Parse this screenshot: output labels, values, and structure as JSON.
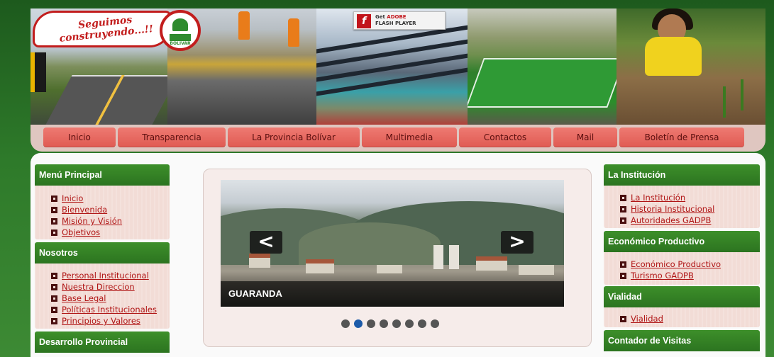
{
  "banner": {
    "logo_text": "Seguimos construyendo...!!",
    "seal_text": "BOLIVAR",
    "flash_badge": {
      "line1_prefix": "Get ",
      "line1_accent": "ADOBE",
      "line2": "FLASH PLAYER"
    }
  },
  "nav": {
    "items": [
      {
        "label": "Inicio"
      },
      {
        "label": "Transparencia"
      },
      {
        "label": "La Provincia Bolívar"
      },
      {
        "label": "Multimedia"
      },
      {
        "label": "Contactos"
      },
      {
        "label": "Mail"
      },
      {
        "label": "Boletín de Prensa"
      }
    ]
  },
  "left_sidebar": {
    "blocks": [
      {
        "title": "Menú Principal",
        "links": [
          "Inicio",
          "Bienvenida",
          "Misión y Visión",
          "Objetivos"
        ]
      },
      {
        "title": "Nosotros",
        "links": [
          "Personal Institucional",
          "Nuestra Direccion",
          "Base Legal",
          "Políticas Institucionales",
          "Principios y Valores"
        ]
      },
      {
        "title": "Desarrollo Provincial",
        "links": []
      }
    ]
  },
  "right_sidebar": {
    "blocks": [
      {
        "title": "La Institución",
        "links": [
          "La Institución",
          "Historia Institucional",
          "Autoridades GADPB"
        ]
      },
      {
        "title": "Económico Productivo",
        "links": [
          "Económico Productivo",
          "Turismo GADPB"
        ]
      },
      {
        "title": "Vialidad",
        "links": [
          "Vialidad"
        ]
      },
      {
        "title": "Contador de Visitas",
        "links": []
      }
    ]
  },
  "slider": {
    "caption": "GUARANDA",
    "prev_glyph": "<",
    "next_glyph": ">",
    "dot_count": 8,
    "active_dot": 2
  },
  "colors": {
    "header_green": "#2c7420",
    "nav_button": "#e05a52",
    "link_red": "#b01515",
    "active_dot": "#1c5aa8"
  }
}
